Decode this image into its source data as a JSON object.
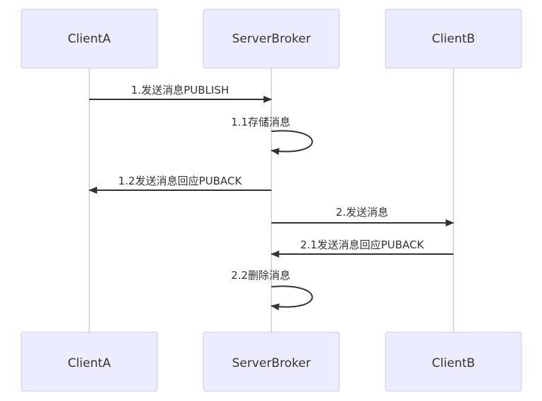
{
  "participants": [
    {
      "id": "clienta",
      "label": "ClientA"
    },
    {
      "id": "serverbroker",
      "label": "ServerBroker"
    },
    {
      "id": "clientb",
      "label": "ClientB"
    }
  ],
  "messages": [
    {
      "from": 0,
      "to": 1,
      "label": "1.发送消息PUBLISH"
    },
    {
      "from": 1,
      "to": 1,
      "label": "1.1存储消息"
    },
    {
      "from": 1,
      "to": 0,
      "label": "1.2发送消息回应PUBACK"
    },
    {
      "from": 1,
      "to": 2,
      "label": "2.发送消息"
    },
    {
      "from": 2,
      "to": 1,
      "label": "2.1发送消息回应PUBACK"
    },
    {
      "from": 1,
      "to": 1,
      "label": "2.2删除消息"
    }
  ],
  "colors": {
    "actor_fill": "#ececff",
    "actor_border": "#c9c9e8",
    "line": "#333333",
    "lifeline": "#b5b5b5"
  }
}
